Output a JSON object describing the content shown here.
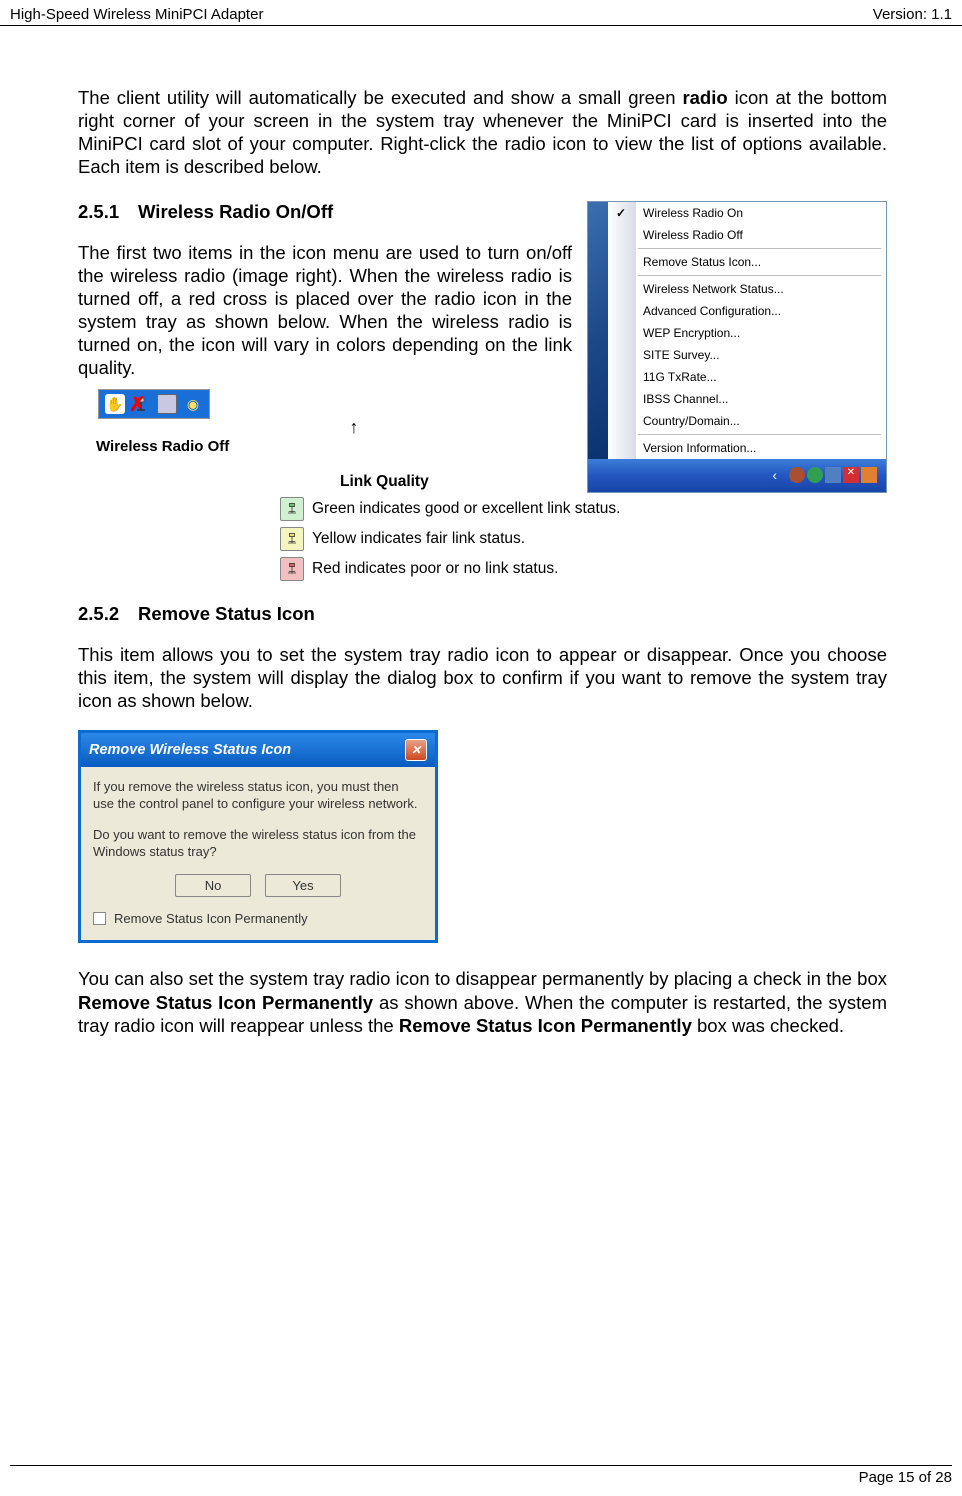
{
  "header": {
    "left": "High-Speed Wireless MiniPCI Adapter",
    "right": "Version: 1.1"
  },
  "intro": "The client utility will automatically be executed and show a small green radio icon at the bottom right corner of your screen in the system tray whenever the MiniPCI card is inserted into the MiniPCI card slot of your computer. Right-click the radio icon to view the list of options available. Each item is described below.",
  "section251": {
    "num": "2.5.1",
    "title": "Wireless Radio On/Off",
    "body": "The first two items in the icon menu are used to turn on/off the wireless radio (image right). When the wireless radio is turned off, a red cross is placed over the radio icon in the system tray as shown below. When the wireless radio is turned on, the icon will vary in colors depending on the link quality."
  },
  "context_menu": {
    "items": [
      {
        "label": "Wireless Radio On",
        "checked": true
      },
      {
        "label": "Wireless Radio Off"
      },
      {
        "divider": true
      },
      {
        "label": "Remove Status Icon..."
      },
      {
        "divider": true
      },
      {
        "label": "Wireless Network Status..."
      },
      {
        "label": "Advanced Configuration..."
      },
      {
        "label": "WEP Encryption..."
      },
      {
        "label": "SITE Survey..."
      },
      {
        "label": "11G TxRate..."
      },
      {
        "label": "IBSS Channel..."
      },
      {
        "label": "Country/Domain..."
      },
      {
        "divider": true
      },
      {
        "label": "Version Information..."
      }
    ]
  },
  "wireless_off_label": "Wireless Radio Off",
  "link_quality": {
    "header": "Link Quality",
    "rows": [
      {
        "color": "green",
        "text": "Green indicates good or excellent link status."
      },
      {
        "color": "yellow",
        "text": "Yellow indicates fair link status."
      },
      {
        "color": "red",
        "text": "Red indicates poor or no link status."
      }
    ]
  },
  "section252": {
    "num": "2.5.2",
    "title": "Remove Status Icon",
    "body": "This item allows you to set the system tray radio icon to appear or disappear. Once you choose this item, the system will display the dialog box to confirm if you want to remove the system tray icon as shown below."
  },
  "dialog": {
    "title": "Remove Wireless Status Icon",
    "p1": "If you remove the wireless status icon, you must then use the control panel to configure your wireless network.",
    "p2": "Do you want to remove the wireless status icon from the Windows status tray?",
    "btn_no": "No",
    "btn_yes": "Yes",
    "checkbox": "Remove Status Icon Permanently"
  },
  "para_after_dialog": "You can also set the system tray radio icon to disappear permanently by placing a check in the box Remove Status Icon Permanently as shown above. When the computer is restarted, the system tray radio icon will reappear unless the Remove Status Icon Permanently box was checked.",
  "footer": "Page 15 of 28"
}
